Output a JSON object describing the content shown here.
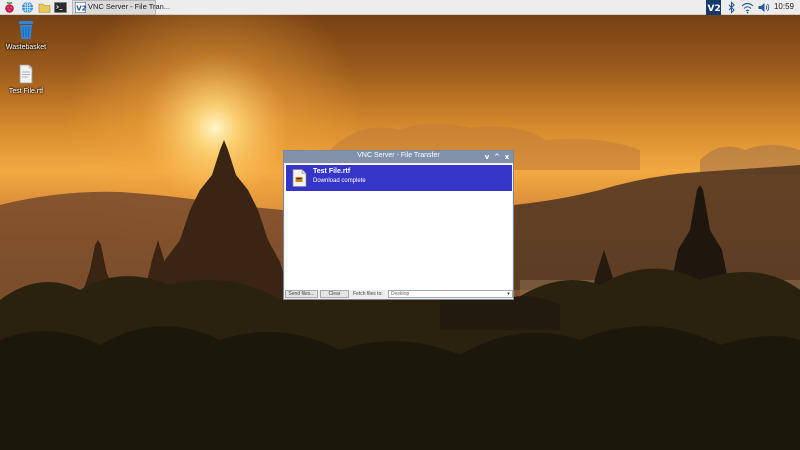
{
  "taskbar": {
    "task_label": "VNC Server - File Tran...",
    "clock": "10:59",
    "icons": [
      "raspberry-menu-icon",
      "web-browser-icon",
      "file-manager-icon",
      "terminal-icon",
      "vnc-task-icon",
      "vnc-tray-icon",
      "bluetooth-icon",
      "wifi-icon",
      "volume-icon"
    ]
  },
  "desktop": {
    "icons": [
      {
        "label": "Wastebasket"
      },
      {
        "label": "Test File.rtf"
      }
    ]
  },
  "dialog": {
    "title": "VNC Server - File Transfer",
    "controls": [
      "v",
      "^",
      "x"
    ],
    "transfer": {
      "filename": "Test File.rtf",
      "status": "Download complete"
    },
    "send_button": "Send files...",
    "clear_button": "Clear",
    "fetch_label": "Fetch files to:",
    "fetch_destination": "Desktop"
  },
  "colors": {
    "titlebar": "#8292aa",
    "selection": "#3535c8",
    "taskbar": "#ededed"
  }
}
